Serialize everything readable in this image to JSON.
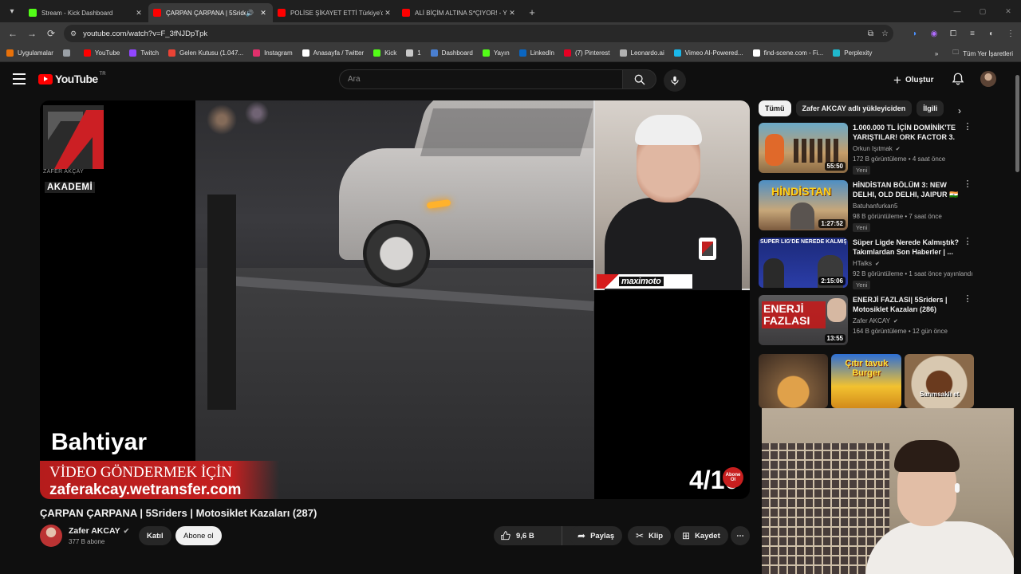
{
  "browser": {
    "tabs": [
      {
        "title": "Stream - Kick Dashboard",
        "favicon_color": "#53fc18",
        "active": false
      },
      {
        "title": "ÇARPAN ÇARPANA | 5Sriders",
        "favicon_color": "#ff0000",
        "active": true,
        "audio": true
      },
      {
        "title": "POLİSE ŞİKAYET ETTİ Türkiye'd",
        "favicon_color": "#ff0000",
        "active": false
      },
      {
        "title": "ALİ BİÇİM ALTINA S*ÇIYOR! - Y",
        "favicon_color": "#ff0000",
        "active": false
      }
    ],
    "url": "youtube.com/watch?v=F_3fNJDpTpk",
    "bookmarks": [
      {
        "label": "Uygulamalar",
        "icon": "apps-icon",
        "color": "#e8710a"
      },
      {
        "label": "",
        "icon": "grid-icon",
        "color": "#9aa0a6"
      },
      {
        "label": "YouTube",
        "icon": "youtube-icon",
        "color": "#ff0000"
      },
      {
        "label": "Twitch",
        "icon": "twitch-icon",
        "color": "#9146ff"
      },
      {
        "label": "Gelen Kutusu (1.047...",
        "icon": "gmail-icon",
        "color": "#ea4335"
      },
      {
        "label": "Instagram",
        "icon": "instagram-icon",
        "color": "#e1306c"
      },
      {
        "label": "Anasayfa / Twitter",
        "icon": "x-icon",
        "color": "#ffffff"
      },
      {
        "label": "Kick",
        "icon": "kick-icon",
        "color": "#53fc18"
      },
      {
        "label": "1",
        "icon": "folder-icon",
        "color": "#c8c8c8"
      },
      {
        "label": "Dashboard",
        "icon": "dashboard-icon",
        "color": "#4a7fd1"
      },
      {
        "label": "Yayın",
        "icon": "kick-icon",
        "color": "#53fc18"
      },
      {
        "label": "LinkedIn",
        "icon": "linkedin-icon",
        "color": "#0a66c2"
      },
      {
        "label": "(7) Pinterest",
        "icon": "pinterest-icon",
        "color": "#e60023"
      },
      {
        "label": "Leonardo.ai",
        "icon": "leonardo-icon",
        "color": "#b0b0b0"
      },
      {
        "label": "Vimeo AI-Powered...",
        "icon": "vimeo-icon",
        "color": "#1ab7ea"
      },
      {
        "label": "find-scene.com - Fi...",
        "icon": "find-scene-icon",
        "color": "#ffffff"
      },
      {
        "label": "Perplexity",
        "icon": "perplexity-icon",
        "color": "#20b8cd"
      }
    ],
    "all_bookmarks": "Tüm Yer İşaretleri"
  },
  "youtube": {
    "logo": "YouTube",
    "region": "TR",
    "search_placeholder": "Ara",
    "create_label": "Oluştur"
  },
  "video": {
    "title": "ÇARPAN ÇARPANA | 5Sriders | Motosiklet Kazaları (287)",
    "overlay_name": "Bahtiyar",
    "overlay_line1": "VİDEO GÖNDERMEK İÇİN",
    "overlay_line2": "zaferakcay.wetransfer.com",
    "counter": "4/10",
    "abone_badge": "Abone Ol",
    "logo_sub": "ZAFER AKÇAY",
    "logo_akademi": "AKADEMİ",
    "sponsor": "maximoto",
    "channel": "Zafer AKCAY",
    "subscribers": "377 B abone",
    "join_label": "Katıl",
    "subscribe_label": "Abone ol",
    "likes": "9,6 B",
    "share_label": "Paylaş",
    "clip_label": "Klip",
    "save_label": "Kaydet"
  },
  "sidebar": {
    "chips": [
      "Tümü",
      "Zafer AKCAY adlı yükleyiciden",
      "İlgili"
    ],
    "recommendations": [
      {
        "title": "1.000.000 TL İÇİN DOMİNİK'TE YARIŞTILAR! ORK FACTOR 3. ...",
        "channel": "Orkun Işıtmak",
        "verified": true,
        "meta": "172 B görüntüleme • 4 saat önce",
        "badge": "Yeni",
        "duration": "55:50"
      },
      {
        "title": "HİNDİSTAN BÖLÜM 3: NEW DELHI, OLD DELHI, JAIPUR 🇮🇳",
        "channel": "Batuhanfurkan5",
        "verified": false,
        "meta": "98 B görüntüleme • 7 saat önce",
        "badge": "Yeni",
        "duration": "1:27:52",
        "thumb_text": "HİNDİSTAN"
      },
      {
        "title": "Süper Ligde Nerede Kalmıştık? Takımlardan Son Haberler | ...",
        "channel": "HTalks",
        "verified": true,
        "meta": "92 B görüntüleme • 1 saat önce yayınlandı",
        "badge": "Yeni",
        "duration": "2:15:06",
        "thumb_text": "SÜPER LİG'DE NEREDE KALMIŞTIK?"
      },
      {
        "title": "ENERJİ FAZLASI| 5Sriders | Motosiklet Kazaları (286)",
        "channel": "Zafer AKCAY",
        "verified": true,
        "meta": "164 B görüntüleme • 12 gün önce",
        "badge": "",
        "duration": "13:55",
        "thumb_text": "ENERJİ FAZLASI"
      }
    ],
    "shorts": [
      {
        "text": ""
      },
      {
        "text": "Çıtır tavuk Burger"
      },
      {
        "text": "Sarımsaklı et"
      }
    ]
  }
}
